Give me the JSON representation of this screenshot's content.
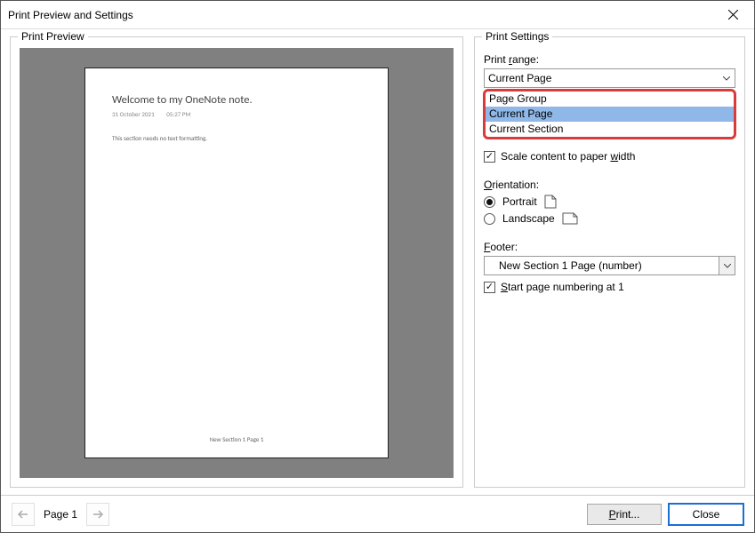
{
  "window": {
    "title": "Print Preview and Settings"
  },
  "preview": {
    "legend": "Print Preview",
    "page": {
      "title": "Welcome to my OneNote note.",
      "date": "31 October 2021",
      "time": "05:27 PM",
      "body": "This section needs no text formatting.",
      "footer": "New Section 1 Page 1"
    }
  },
  "settings": {
    "legend": "Print Settings",
    "printRange": {
      "label_pre": "Print",
      "label_u": "r",
      "label_post": "ange:",
      "value": "Current Page",
      "options": [
        "Page Group",
        "Current Page",
        "Current Section"
      ],
      "selectedIndex": 1
    },
    "scale": {
      "pre": "Scale content to paper",
      "u": "w",
      "post": "idth",
      "checked": true
    },
    "orientation": {
      "label_u": "O",
      "label_post": "rientation:",
      "portrait": "Portrait",
      "landscape": "Landscape",
      "value": "portrait"
    },
    "footer": {
      "label_u": "F",
      "label_post": "ooter:",
      "value": "New Section 1 Page (number)"
    },
    "startNumbering": {
      "u": "S",
      "post": "tart page numbering at 1",
      "checked": true
    }
  },
  "nav": {
    "page_label": "Page 1"
  },
  "buttons": {
    "print_u": "P",
    "print_post": "rint...",
    "close": "Close"
  }
}
